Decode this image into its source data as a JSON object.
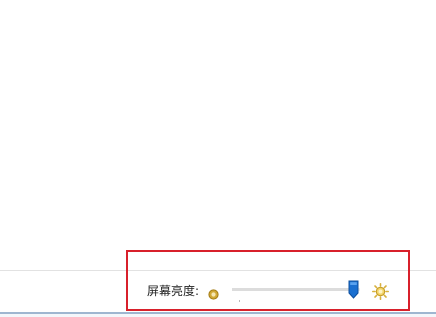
{
  "status_bar": {
    "brightness_label": "屏幕亮度:",
    "dim_icon": "dim-sun-icon",
    "bright_icon": "bright-sun-icon",
    "brightness_level": 0.95
  },
  "colors": {
    "highlight": "#d8202b",
    "thumb": "#1a6fd0",
    "icon_gold": "#c9a12b"
  }
}
